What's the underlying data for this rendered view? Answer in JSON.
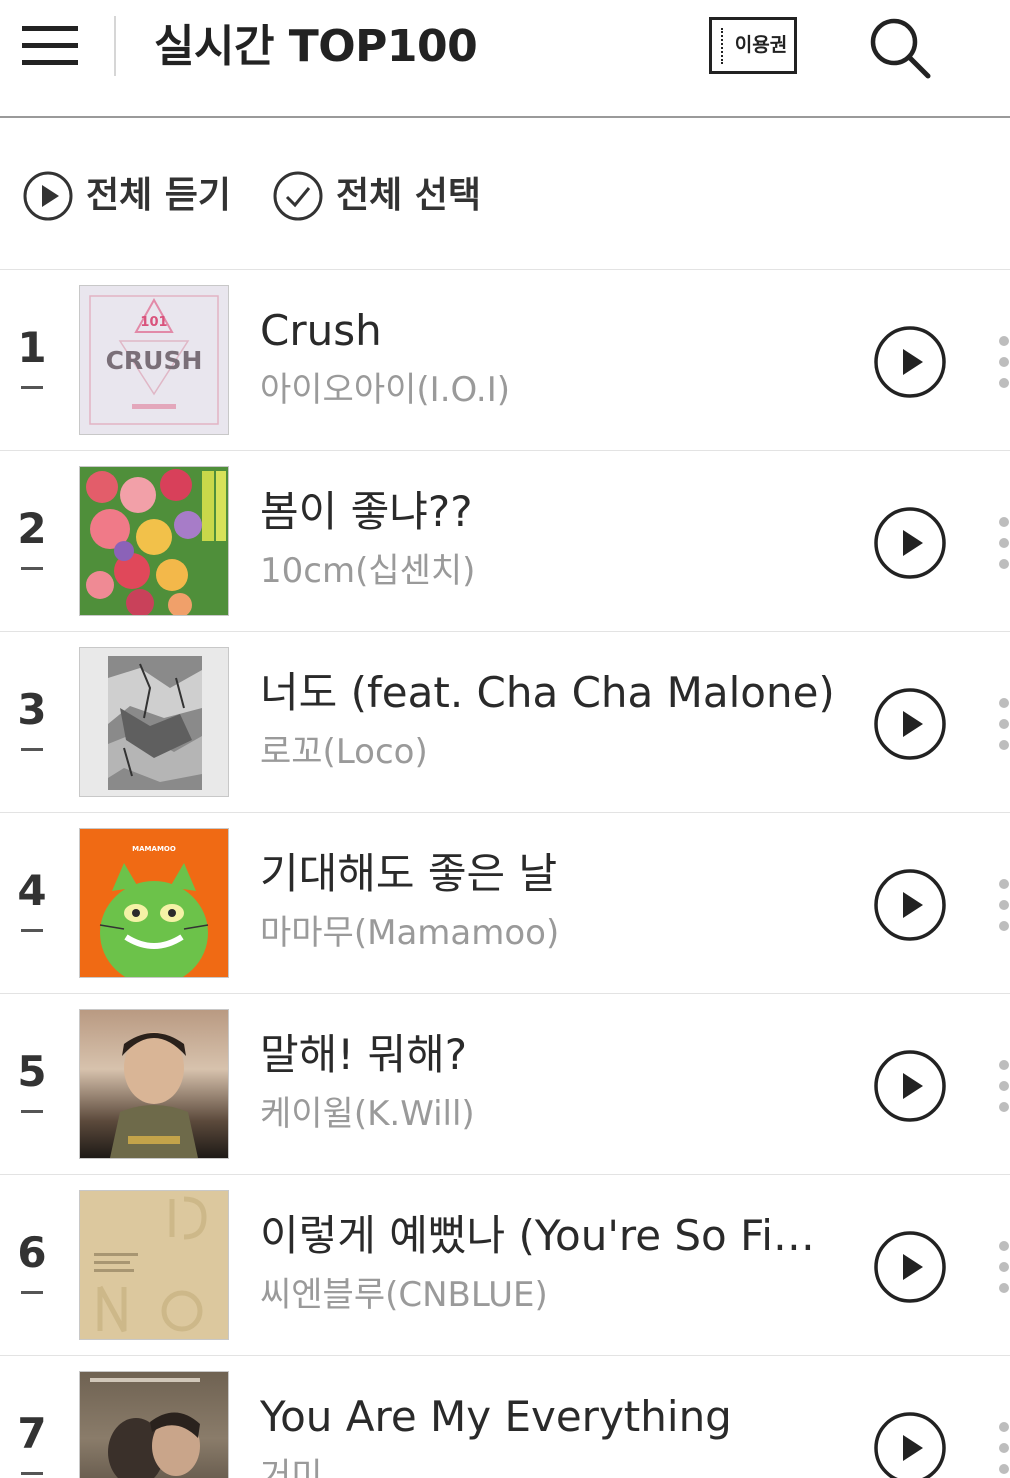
{
  "header": {
    "menu_icon": "hamburger-menu-icon",
    "title": "실시간 TOP100",
    "ticket_label": "이용권",
    "search_icon": "search-icon"
  },
  "controls": {
    "play_all_label": "전체 듣기",
    "select_all_label": "전체 선택"
  },
  "songs": [
    {
      "rank": "1",
      "title": "Crush",
      "artist": "아이오아이(I.O.I)",
      "art_text": "CRUSH",
      "art_badge": "101"
    },
    {
      "rank": "2",
      "title": "봄이 좋냐??",
      "artist": "10cm(십센치)"
    },
    {
      "rank": "3",
      "title": "너도 (feat. Cha Cha Malone)",
      "artist": "로꼬(Loco)"
    },
    {
      "rank": "4",
      "title": "기대해도 좋은 날",
      "artist": "마마무(Mamamoo)",
      "art_text": "MAMAMOO"
    },
    {
      "rank": "5",
      "title": "말해! 뭐해?",
      "artist": "케이윌(K.Will)"
    },
    {
      "rank": "6",
      "title": "이렇게 예뻤나 (You're So Fine)",
      "artist": "씨엔블루(CNBLUE)"
    },
    {
      "rank": "7",
      "title": "You Are My Everything",
      "artist": "거미"
    }
  ]
}
